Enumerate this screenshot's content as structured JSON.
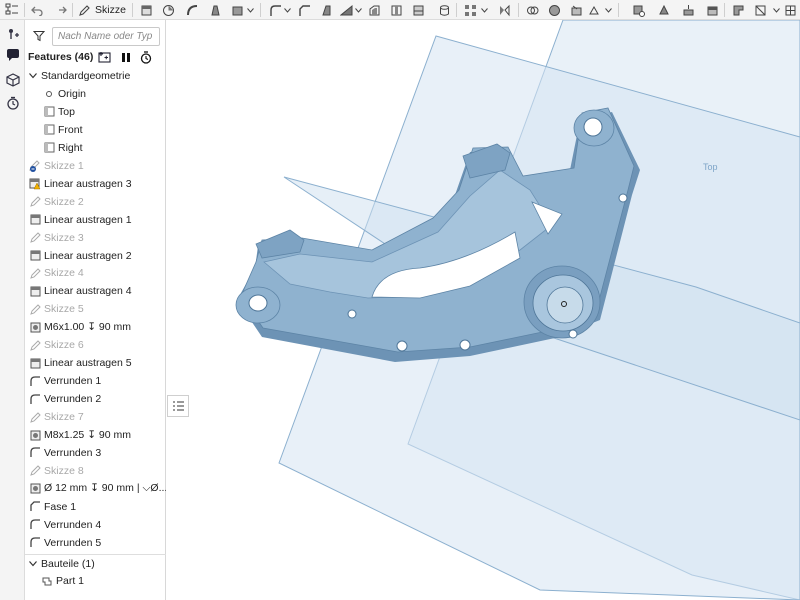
{
  "toolbar": {
    "sketch_label": "Skizze"
  },
  "panel": {
    "search_placeholder": "Nach Name oder Typ fi",
    "features_title": "Features (46)",
    "tree": [
      {
        "label": "Standardgeometrie",
        "type": "group",
        "dim": false
      },
      {
        "label": "Origin",
        "type": "origin",
        "dim": false
      },
      {
        "label": "Top",
        "type": "plane",
        "dim": false
      },
      {
        "label": "Front",
        "type": "plane",
        "dim": false
      },
      {
        "label": "Right",
        "type": "plane",
        "dim": false
      },
      {
        "label": "Skizze 1",
        "type": "sketch-error",
        "dim": true
      },
      {
        "label": "Linear austragen 3",
        "type": "extrude-warn",
        "dim": false
      },
      {
        "label": "Skizze 2",
        "type": "sketch",
        "dim": true
      },
      {
        "label": "Linear austragen 1",
        "type": "extrude",
        "dim": false
      },
      {
        "label": "Skizze 3",
        "type": "sketch",
        "dim": true
      },
      {
        "label": "Linear austragen 2",
        "type": "extrude",
        "dim": false
      },
      {
        "label": "Skizze 4",
        "type": "sketch",
        "dim": true
      },
      {
        "label": "Linear austragen 4",
        "type": "extrude",
        "dim": false
      },
      {
        "label": "Skizze 5",
        "type": "sketch",
        "dim": true
      },
      {
        "label": "M6x1.00 ↧ 90 mm",
        "type": "hole",
        "dim": false
      },
      {
        "label": "Skizze 6",
        "type": "sketch",
        "dim": true
      },
      {
        "label": "Linear austragen 5",
        "type": "extrude",
        "dim": false
      },
      {
        "label": "Verrunden 1",
        "type": "fillet",
        "dim": false
      },
      {
        "label": "Verrunden 2",
        "type": "fillet",
        "dim": false
      },
      {
        "label": "Skizze 7",
        "type": "sketch",
        "dim": true
      },
      {
        "label": "M8x1.25 ↧ 90 mm",
        "type": "hole",
        "dim": false
      },
      {
        "label": "Verrunden 3",
        "type": "fillet",
        "dim": false
      },
      {
        "label": "Skizze 8",
        "type": "sketch",
        "dim": true
      },
      {
        "label": "Ø 12 mm ↧ 90 mm | ⌵Ø...",
        "type": "hole",
        "dim": false
      },
      {
        "label": "Fase 1",
        "type": "chamfer",
        "dim": false
      },
      {
        "label": "Verrunden 4",
        "type": "fillet",
        "dim": false
      },
      {
        "label": "Verrunden 5",
        "type": "fillet",
        "dim": false
      }
    ],
    "parts_title": "Bauteile (1)",
    "parts": [
      {
        "label": "Part 1"
      }
    ]
  },
  "viewport": {
    "plane_label": "Top"
  },
  "colors": {
    "part_fill": "#8fb3d0",
    "part_dark": "#5f86a9",
    "plane_fill": "#d3e3f1",
    "plane_edge": "#7ea5c8"
  }
}
